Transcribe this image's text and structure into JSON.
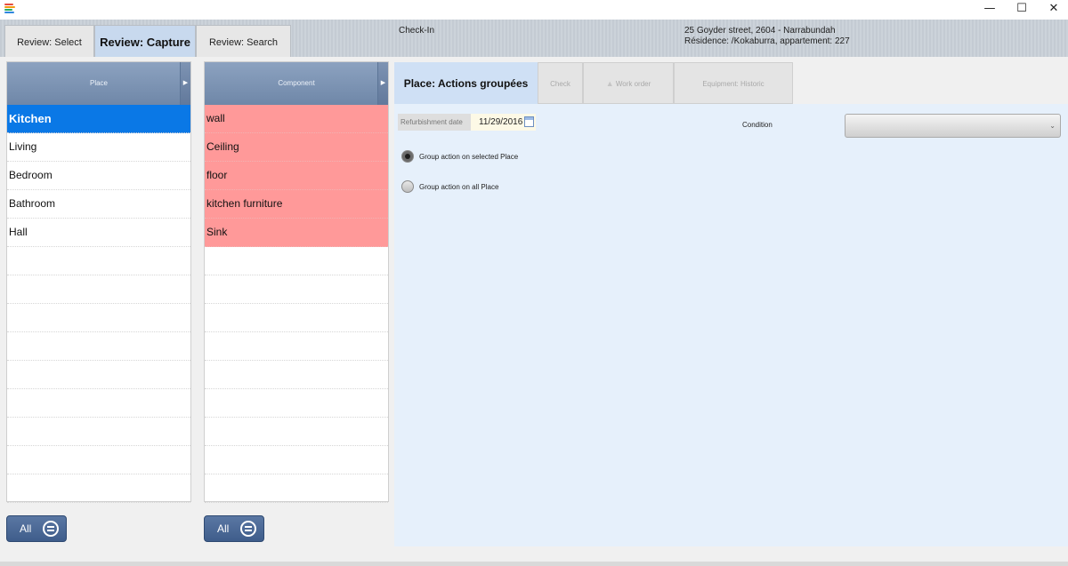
{
  "window": {
    "minimize_glyph": "—",
    "maximize_glyph": "☐",
    "close_glyph": "✕",
    "logo_colors": [
      "#e74c3c",
      "#f39c12",
      "#27ae60",
      "#2e86de"
    ]
  },
  "tabs": [
    {
      "label": "Review: Select",
      "active": false
    },
    {
      "label": "Review: Capture",
      "active": true
    },
    {
      "label": "Review: Search",
      "active": false
    }
  ],
  "header": {
    "mode": "Check-In",
    "address_line1": "25 Goyder street, 2604 - Narrabundah",
    "address_line2": "Résidence: /Kokaburra, appartement: 227"
  },
  "place_list": {
    "header": "Place",
    "items": [
      "Kitchen",
      "Living",
      "Bedroom",
      "Bathroom",
      "Hall"
    ],
    "selected": "Kitchen",
    "all_button": "All"
  },
  "component_list": {
    "header": "Component",
    "items": [
      "wall",
      "Ceiling",
      "floor",
      "kitchen furniture",
      "Sink"
    ],
    "all_button": "All"
  },
  "right_tabs": [
    {
      "label": "Place: Actions groupées",
      "active": true
    },
    {
      "label": "Check",
      "active": false
    },
    {
      "label": "Work order",
      "active": false
    },
    {
      "label": "Equipment: Historic",
      "active": false
    }
  ],
  "form": {
    "refurbishment_label": "Refurbishment date",
    "refurbishment_value": "11/29/2016",
    "condition_label": "Condition",
    "condition_value": "",
    "radio_selected_label": "Group action on selected Place",
    "radio_all_label": "Group action on all Place",
    "radio_selected_checked": true
  },
  "colors": {
    "selected_row": "#0a78e6",
    "component_row": "#ff9999",
    "list_header": "#7b92b3",
    "active_tab": "#c8d9ee",
    "panel_bg": "#e6f0fb"
  }
}
